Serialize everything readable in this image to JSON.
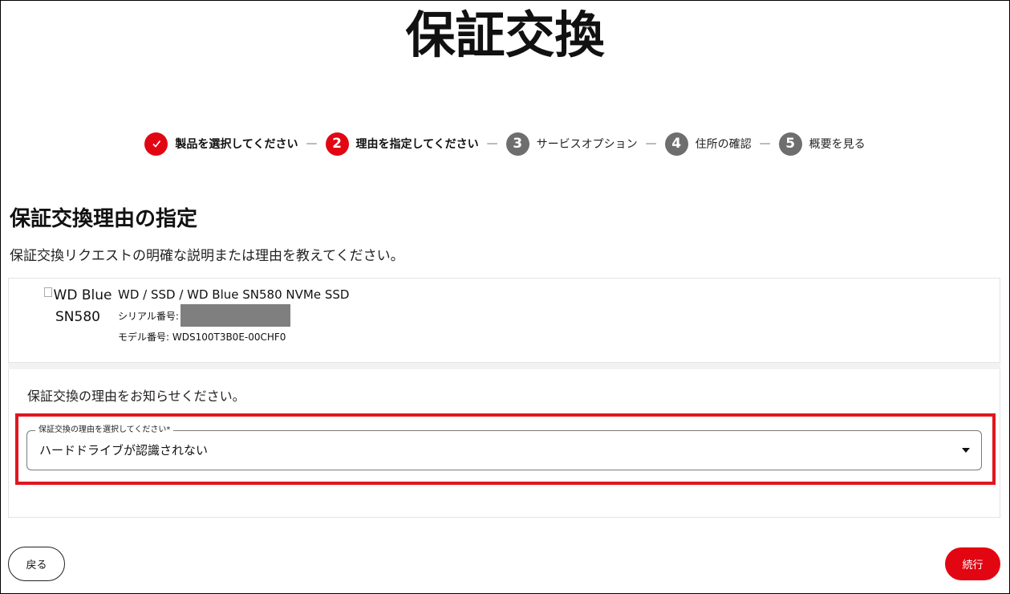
{
  "page": {
    "title": "保証交換"
  },
  "stepper": {
    "steps": [
      {
        "number": "✓",
        "label": "製品を選択してください",
        "state": "done"
      },
      {
        "number": "2",
        "label": "理由を指定してください",
        "state": "active"
      },
      {
        "number": "3",
        "label": "サービスオプション",
        "state": "pending"
      },
      {
        "number": "4",
        "label": "住所の確認",
        "state": "pending"
      },
      {
        "number": "5",
        "label": "概要を見る",
        "state": "pending"
      }
    ],
    "separator": "—"
  },
  "section": {
    "title": "保証交換理由の指定",
    "description": "保証交換リクエストの明確な説明または理由を教えてください。"
  },
  "product": {
    "image_alt_line1": "WD Blue",
    "image_alt_line2": "SN580",
    "name": "WD / SSD / WD Blue SN580 NVMe SSD",
    "serial_label": "シリアル番号:",
    "model_label": "モデル番号: WDS100T3B0E-00CHF0"
  },
  "reason": {
    "question": "保証交換の理由をお知らせください。",
    "select_label": "保証交換の理由を選択してください*",
    "select_value": "ハードドライブが認識されない"
  },
  "actions": {
    "back_label": "戻る",
    "continue_label": "続行"
  },
  "colors": {
    "accent": "#e20613",
    "step_pending": "#6e6e6e",
    "highlight_border": "#e0161f"
  }
}
